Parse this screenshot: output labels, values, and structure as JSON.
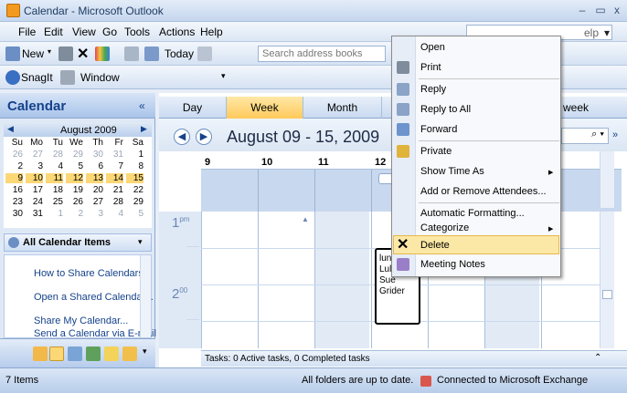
{
  "window": {
    "title": "Calendar - Microsoft Outlook"
  },
  "menu": {
    "file": "File",
    "edit": "Edit",
    "view": "View",
    "go": "Go",
    "tools": "Tools",
    "actions": "Actions",
    "help": "Help"
  },
  "help_box": {
    "text": "elp"
  },
  "toolbar": {
    "new": "New",
    "today": "Today",
    "search_placeholder": "Search address books"
  },
  "toolbar2": {
    "snagit": "SnagIt",
    "window": "Window"
  },
  "nav": {
    "title": "Calendar",
    "collapse": "«",
    "month_title": "August 2009",
    "weekdays": [
      "Su",
      "Mo",
      "Tu",
      "We",
      "Th",
      "Fr",
      "Sa"
    ],
    "weeks": [
      [
        "26",
        "27",
        "28",
        "29",
        "30",
        "31",
        "1"
      ],
      [
        "2",
        "3",
        "4",
        "5",
        "6",
        "7",
        "8"
      ],
      [
        "9",
        "10",
        "11",
        "12",
        "13",
        "14",
        "15"
      ],
      [
        "16",
        "17",
        "18",
        "19",
        "20",
        "21",
        "22"
      ],
      [
        "23",
        "24",
        "25",
        "26",
        "27",
        "28",
        "29"
      ],
      [
        "30",
        "31",
        "1",
        "2",
        "3",
        "4",
        "5"
      ]
    ],
    "all_items": "All Calendar Items",
    "links": [
      "How to Share Calendars",
      "Open a Shared Calendar...",
      "Share My Calendar...",
      "Send a Calendar via E-mail"
    ]
  },
  "views": {
    "day": "Day",
    "week": "Week",
    "month": "Month",
    "show_week": "week"
  },
  "calendar": {
    "date_range": "August 09 - 15, 2009",
    "days": [
      "9",
      "10",
      "11",
      "12"
    ],
    "hours": [
      {
        "h": "1",
        "m": "pm"
      },
      {
        "h": "2",
        "m": "00"
      }
    ],
    "appointment": [
      "lun",
      "Lul",
      "Sue",
      "Grider"
    ]
  },
  "tasks": {
    "summary": "Tasks: 0 Active tasks, 0 Completed tasks"
  },
  "status": {
    "items": "7 Items",
    "folders": "All folders are up to date.",
    "exchange": "Connected to Microsoft Exchange"
  },
  "context_menu": {
    "open": "Open",
    "print": "Print",
    "reply": "Reply",
    "reply_all": "Reply to All",
    "forward": "Forward",
    "private": "Private",
    "show_time_as": "Show Time As",
    "attendees": "Add or Remove Attendees...",
    "auto_format": "Automatic Formatting...",
    "categorize": "Categorize",
    "delete": "Delete",
    "meeting_notes": "Meeting Notes"
  }
}
